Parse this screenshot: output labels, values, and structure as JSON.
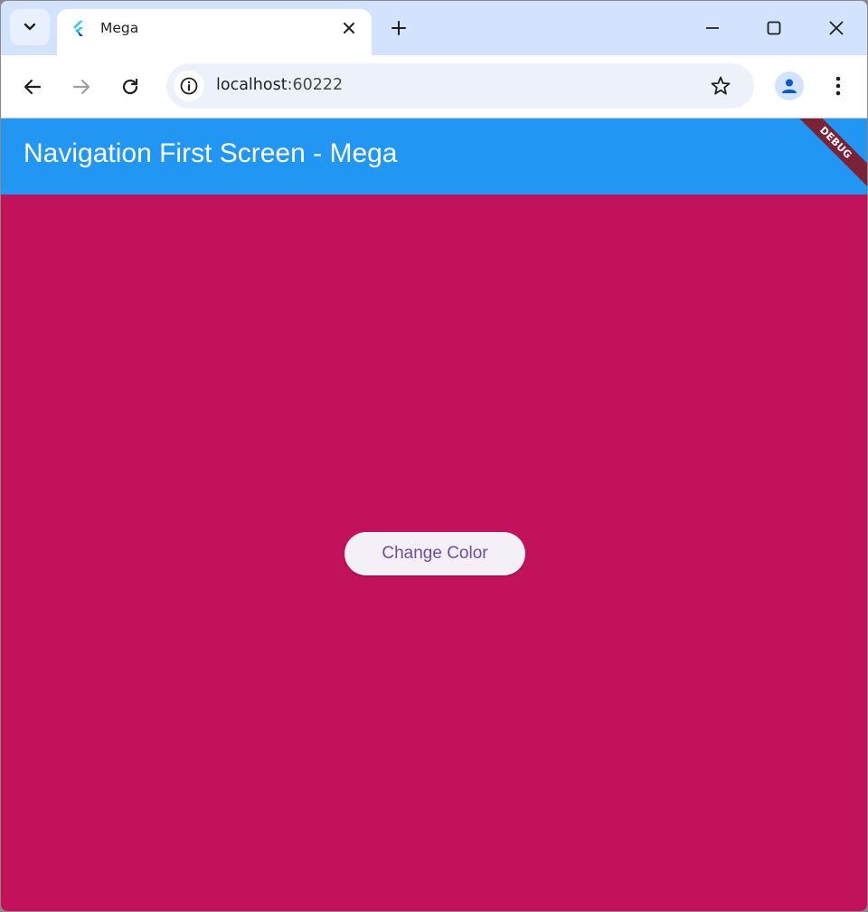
{
  "browser": {
    "tab": {
      "title": "Mega",
      "favicon": "flutter-logo-icon"
    },
    "address_bar": {
      "host": "localhost",
      "port": ":60222"
    },
    "icons": {
      "tab_search": "chevron-down-icon",
      "close_tab": "close-icon",
      "new_tab": "plus-icon",
      "minimize": "minimize-icon",
      "maximize": "maximize-icon",
      "close_window": "close-icon",
      "back": "arrow-left-icon",
      "forward": "arrow-right-icon",
      "reload": "reload-icon",
      "site_info": "info-icon",
      "bookmark": "star-icon",
      "profile": "person-icon",
      "menu": "more-vert-icon"
    }
  },
  "app": {
    "appbar_title": "Navigation First Screen - Mega",
    "debug_banner": "DEBUG",
    "button_label": "Change Color",
    "colors": {
      "appbar": "#2196f3",
      "background": "#c2125c",
      "button_bg": "#f5eff7",
      "button_text": "#6a4fa0"
    }
  }
}
